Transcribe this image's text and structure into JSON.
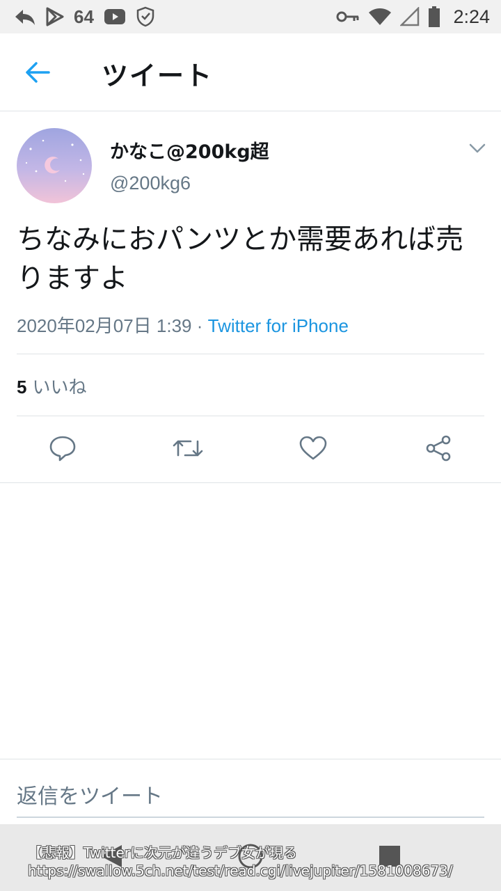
{
  "status_bar": {
    "notification_count": "64",
    "time": "2:24",
    "icons": [
      "reply-icon",
      "play-store-icon",
      "youtube-icon",
      "shield-icon",
      "key-icon",
      "wifi-icon",
      "signal-icon",
      "battery-icon"
    ]
  },
  "header": {
    "title": "ツイート",
    "back_icon": "arrow-left-icon"
  },
  "tweet": {
    "display_name": "かなこ@200kg超",
    "handle": "@200kg6",
    "text": "ちなみにおパンツとか需要あれば売りますよ",
    "timestamp": "2020年02月07日 1:39",
    "separator": " · ",
    "source": "Twitter for iPhone",
    "likes_count": "5",
    "likes_label": "いいね"
  },
  "actions": [
    "reply-icon",
    "retweet-icon",
    "like-icon",
    "share-icon"
  ],
  "reply": {
    "placeholder": "返信をツイート"
  },
  "overlay": {
    "line1": "【悲報】Twitterに次元が違うデブ女が現る",
    "line2": "https://swallow.5ch.net/test/read.cgi/livejupiter/1581008673/"
  },
  "colors": {
    "accent": "#1b95e0",
    "secondary_text": "#657786",
    "primary_text": "#14171a",
    "divider": "#dfe3e6"
  }
}
